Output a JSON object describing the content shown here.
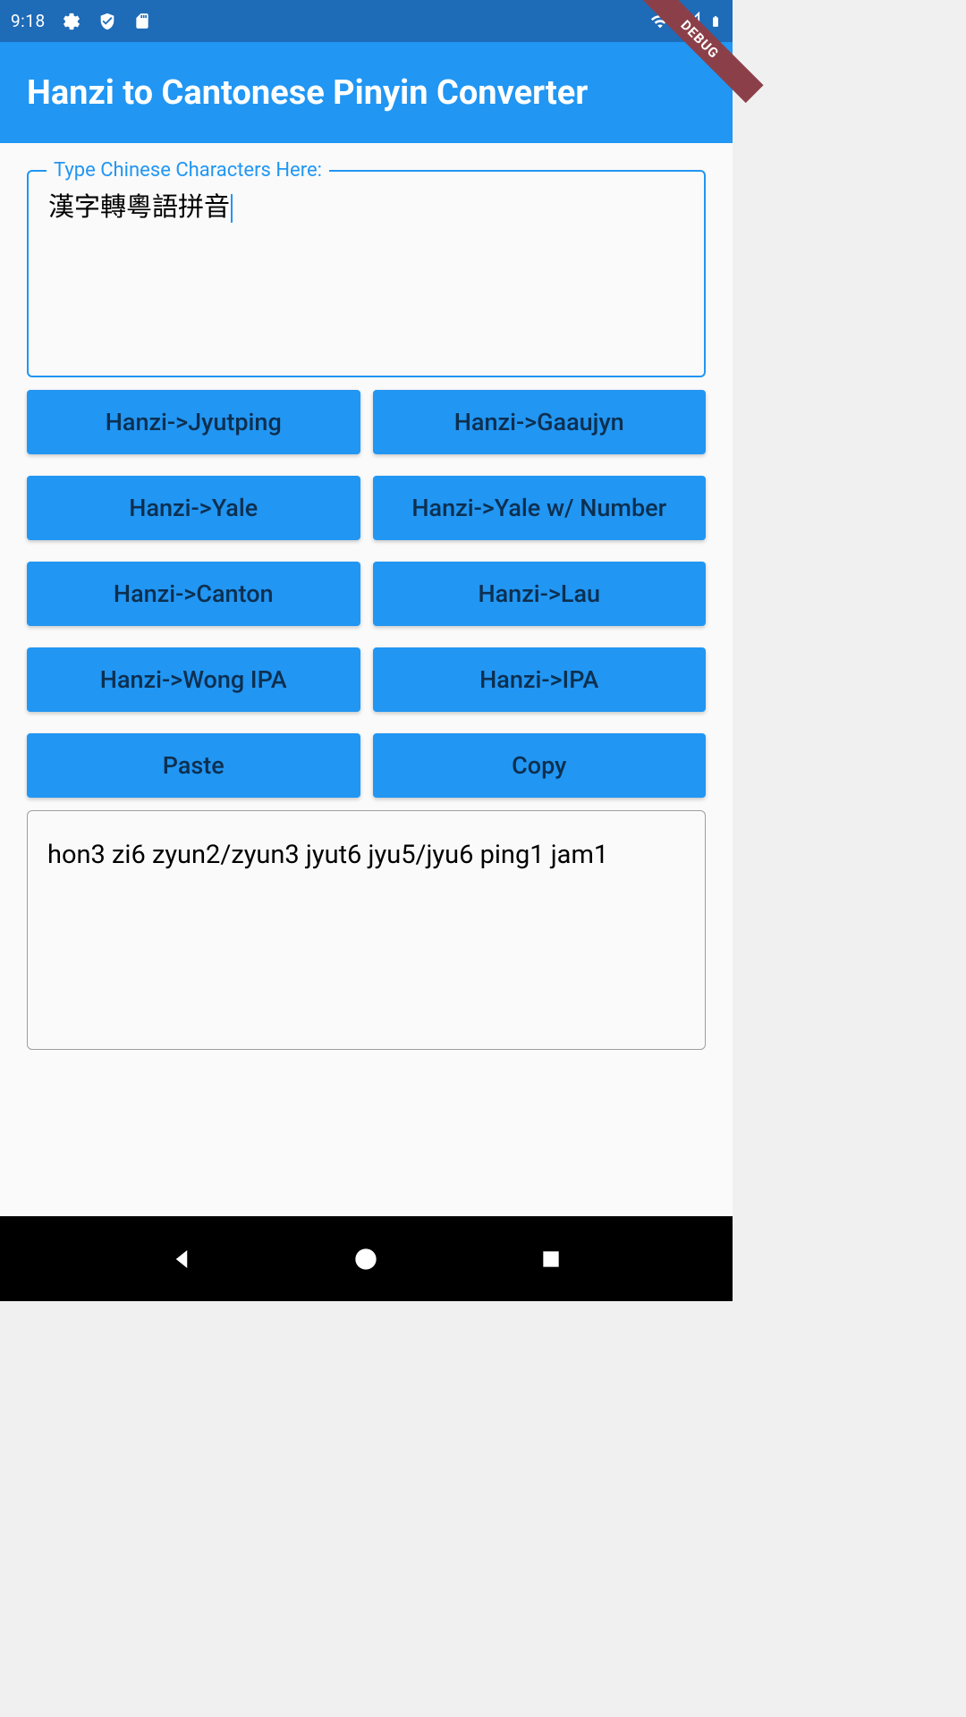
{
  "status": {
    "time": "9:18"
  },
  "debug_label": "DEBUG",
  "app": {
    "title": "Hanzi to Cantonese Pinyin Converter"
  },
  "input": {
    "label": "Type Chinese Characters Here:",
    "value": "漢字轉粵語拼音"
  },
  "buttons": {
    "jyutping": "Hanzi->Jyutping",
    "gaaujyn": "Hanzi->Gaaujyn",
    "yale": "Hanzi->Yale",
    "yale_number": "Hanzi->Yale w/ Number",
    "canton": "Hanzi->Canton",
    "lau": "Hanzi->Lau",
    "wong_ipa": "Hanzi->Wong IPA",
    "ipa": "Hanzi->IPA",
    "paste": "Paste",
    "copy": "Copy"
  },
  "output": {
    "value": "hon3 zi6 zyun2/zyun3 jyut6 jyu5/jyu6 ping1 jam1"
  }
}
